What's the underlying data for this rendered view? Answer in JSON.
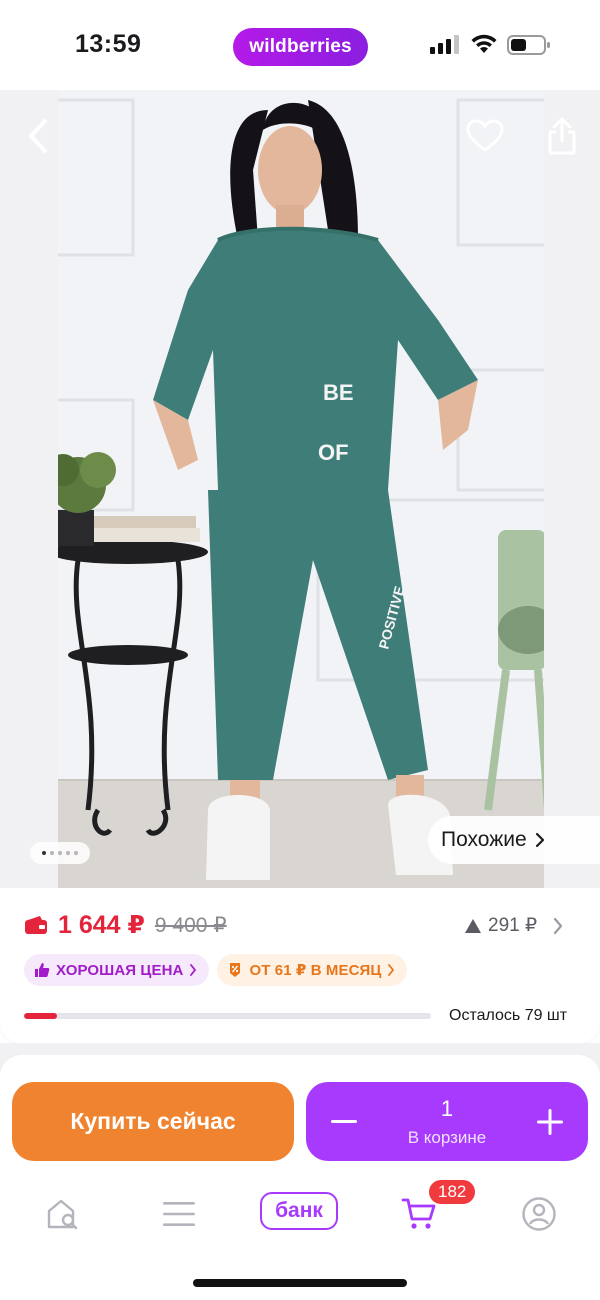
{
  "status_bar": {
    "time": "13:59",
    "brand": "wildberries"
  },
  "gallery": {
    "similar_label": "Похожие",
    "page_dots": 5,
    "active_dot": 0
  },
  "price": {
    "current": "1 644 ₽",
    "old": "9 400 ₽",
    "change": "291 ₽"
  },
  "badges": {
    "good_price": "ХОРОШАЯ ЦЕНА",
    "installment": "ОТ 61 ₽ В МЕСЯЦ"
  },
  "stock": {
    "text": "Осталось 79 шт",
    "fill_fraction": 0.08
  },
  "actions": {
    "buy_now": "Купить сейчас",
    "quantity": "1",
    "in_cart": "В корзине"
  },
  "tabbar": {
    "bank_label": "банк",
    "cart_count": "182"
  },
  "colors": {
    "brand_purple": "#a73afd",
    "price_red": "#e3243b",
    "buy_orange": "#f0832f",
    "badge_red": "#f13a3e"
  },
  "icons": [
    "back-icon",
    "heart-icon",
    "share-icon",
    "chevron-right-icon",
    "wallet-icon",
    "triangle-up-icon",
    "thumbs-up-icon",
    "percent-tag-icon",
    "minus-icon",
    "plus-icon",
    "home-search-icon",
    "menu-icon",
    "cart-icon",
    "profile-icon"
  ]
}
